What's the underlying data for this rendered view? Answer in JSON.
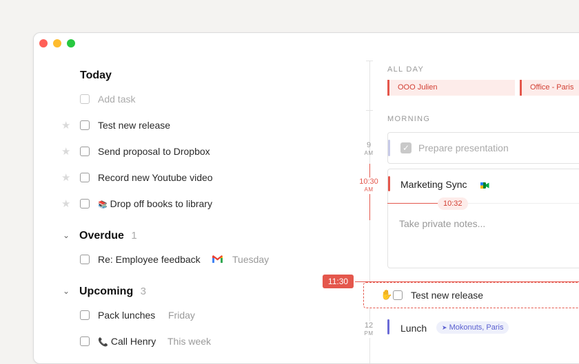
{
  "colors": {
    "accent_red": "#e4574c",
    "lunch_purple": "#6b6bd6"
  },
  "today": {
    "title": "Today",
    "add_task_placeholder": "Add task",
    "tasks": [
      {
        "label": "Test new release",
        "starred": false
      },
      {
        "label": "Send proposal to Dropbox",
        "starred": false
      },
      {
        "label": "Record new Youtube video",
        "starred": false
      },
      {
        "label": "Drop off books to library",
        "emoji": "📚",
        "starred": false
      }
    ]
  },
  "overdue": {
    "title": "Overdue",
    "count": "1",
    "tasks": [
      {
        "label": "Re: Employee feedback",
        "icon": "gmail-icon",
        "date": "Tuesday"
      }
    ]
  },
  "upcoming": {
    "title": "Upcoming",
    "count": "3",
    "tasks": [
      {
        "label": "Pack lunches",
        "date": "Friday"
      },
      {
        "label": "Call Henry",
        "emoji": "📞",
        "date": "This week"
      }
    ]
  },
  "calendar": {
    "all_day_label": "ALL DAY",
    "all_day_events": [
      "OOO Julien",
      "Office - Paris"
    ],
    "morning_label": "MORNING",
    "hours": [
      {
        "time": "9",
        "ampm": "AM"
      },
      {
        "time": "10:30",
        "ampm": "AM"
      },
      {
        "time": "12",
        "ampm": "PM"
      }
    ],
    "drag_time": "11:30",
    "now_time": "10:32",
    "events": {
      "prepare": "Prepare presentation",
      "marketing": "Marketing Sync",
      "notes_placeholder": "Take private notes...",
      "dragged_task": "Test new release",
      "lunch": "Lunch",
      "lunch_location": "Mokonuts, Paris"
    }
  }
}
